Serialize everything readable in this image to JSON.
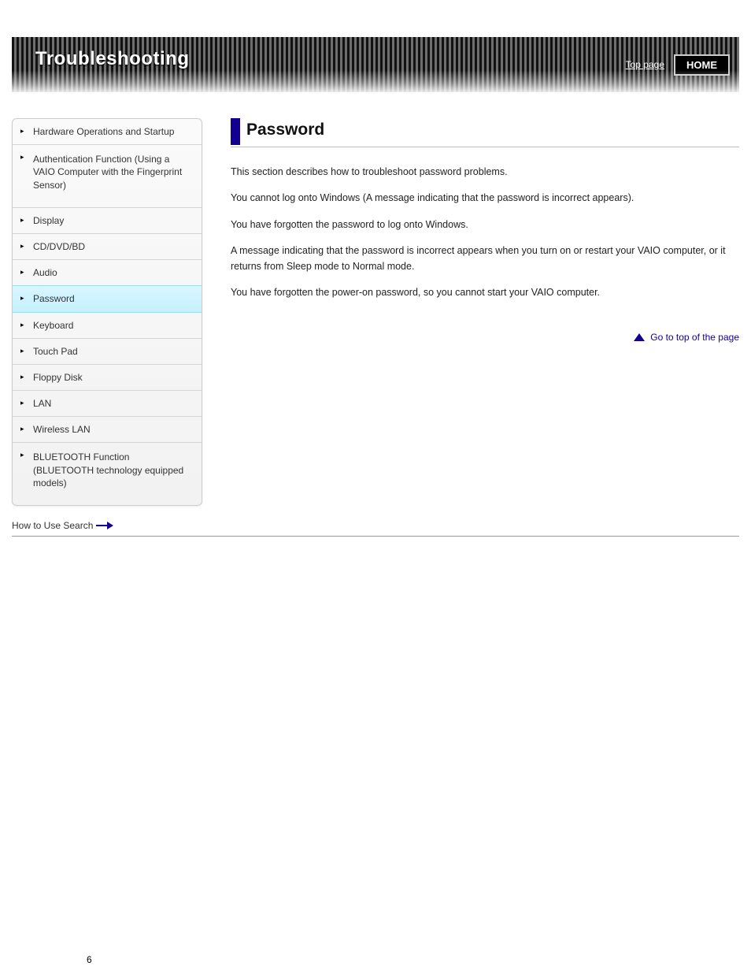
{
  "banner": {
    "title": "Troubleshooting",
    "link_label": "Top page",
    "home_label": "HOME"
  },
  "sidebar": {
    "items": [
      {
        "label": "Hardware Operations and Startup"
      },
      {
        "label": "Authentication Function (Using a VAIO Computer with the Fingerprint Sensor)"
      },
      {
        "label": "Display"
      },
      {
        "label": "CD/DVD/BD"
      },
      {
        "label": "Audio"
      },
      {
        "label": "Password"
      },
      {
        "label": "Keyboard"
      },
      {
        "label": "Touch Pad"
      },
      {
        "label": "Floppy Disk"
      },
      {
        "label": "LAN"
      },
      {
        "label": "Wireless LAN"
      },
      {
        "label": "BLUETOOTH Function (BLUETOOTH technology equipped models)"
      }
    ],
    "selected_index": 5
  },
  "main": {
    "heading": "Password",
    "paragraphs": [
      "This section describes how to troubleshoot password problems.",
      "You cannot log onto Windows (A message indicating that the password is incorrect appears).",
      "You have forgotten the password to log onto Windows.",
      "A message indicating that the password is incorrect appears when you turn on or restart your VAIO computer, or it returns from Sleep mode to Normal mode.",
      "You have forgotten the power-on password, so you cannot start your VAIO computer."
    ],
    "top_label": "Go to top of the page"
  },
  "search": {
    "label": "How to Use Search"
  },
  "page_number": "6"
}
